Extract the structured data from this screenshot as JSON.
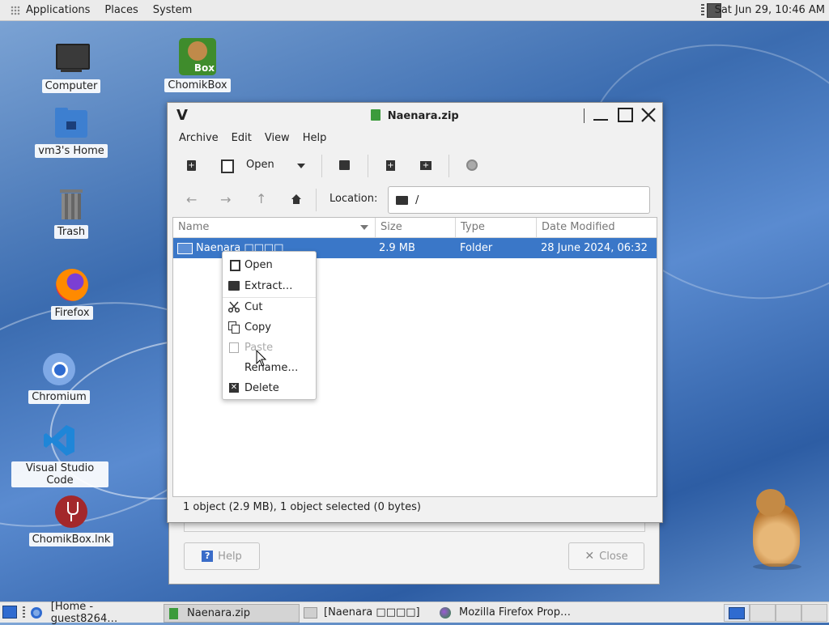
{
  "top_panel": {
    "menus": [
      "Applications",
      "Places",
      "System"
    ],
    "clock": "Sat Jun 29, 10:46 AM"
  },
  "desktop_icons": [
    {
      "label": "Computer",
      "icon": "computer-icon"
    },
    {
      "label": "ChomikBox",
      "icon": "chomikbox-icon"
    },
    {
      "label": "vm3's Home",
      "icon": "home-folder-icon"
    },
    {
      "label": "Trash",
      "icon": "trash-icon"
    },
    {
      "label": "Firefox",
      "icon": "firefox-icon"
    },
    {
      "label": "Chromium",
      "icon": "chromium-icon"
    },
    {
      "label": "Visual Studio Code",
      "icon": "vscode-icon"
    },
    {
      "label": "ChomikBox.lnk",
      "icon": "wine-icon"
    }
  ],
  "chomikbox_badge": "Box",
  "window": {
    "title": "Naenara.zip",
    "app_glyph": "V",
    "menus": [
      "Archive",
      "Edit",
      "View",
      "Help"
    ],
    "toolbar": {
      "open_label": "Open"
    },
    "location": {
      "label": "Location:",
      "path": "/"
    },
    "columns": [
      "Name",
      "Size",
      "Type",
      "Date Modified"
    ],
    "rows": [
      {
        "name": "Naenara □□□□",
        "size": "2.9 MB",
        "type": "Folder",
        "date": "28 June 2024, 06:32"
      }
    ],
    "status": "1 object (2.9 MB), 1 object selected (0 bytes)"
  },
  "behind_dialog": {
    "help_label": "Help",
    "close_label": "Close"
  },
  "context_menu": {
    "items": [
      {
        "label": "Open",
        "icon": "open-icon",
        "enabled": true
      },
      {
        "label": "Extract…",
        "icon": "extract-icon",
        "enabled": true
      },
      {
        "label": "Cut",
        "icon": "cut-icon",
        "enabled": true
      },
      {
        "label": "Copy",
        "icon": "copy-icon",
        "enabled": true
      },
      {
        "label": "Paste",
        "icon": "paste-icon",
        "enabled": false
      },
      {
        "label": "Rename…",
        "icon": "",
        "enabled": true
      },
      {
        "label": "Delete",
        "icon": "delete-icon",
        "enabled": true
      }
    ]
  },
  "taskbar": {
    "tasks": [
      {
        "label": "[Home - guest8264…",
        "icon": "chromium-icon"
      },
      {
        "label": "Naenara.zip",
        "icon": "archive-icon"
      },
      {
        "label": "[Naenara □□□□]",
        "icon": "folder-icon"
      },
      {
        "label": "Mozilla Firefox Prop…",
        "icon": "firefox-prop-icon"
      }
    ]
  },
  "colors": {
    "selection": "#3a77c8",
    "panel": "#ebebeb",
    "accent_green": "#3c9b3c"
  }
}
